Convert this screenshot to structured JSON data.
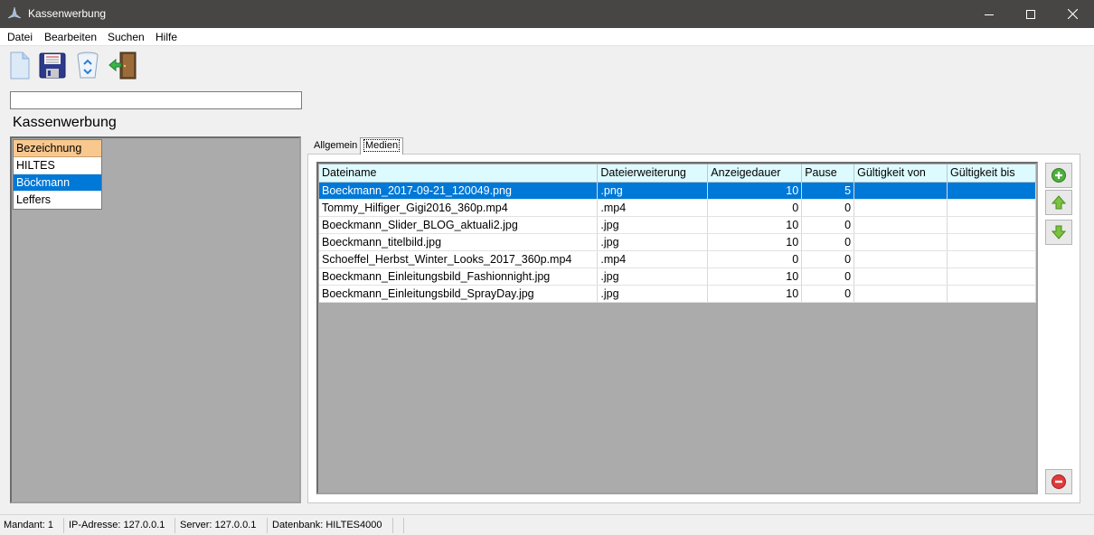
{
  "window": {
    "title": "Kassenwerbung",
    "controls": [
      "minimize-icon",
      "maximize-icon",
      "close-icon"
    ]
  },
  "menu": [
    "Datei",
    "Bearbeiten",
    "Suchen",
    "Hilfe"
  ],
  "toolbar": [
    "new-document-icon",
    "save-icon",
    "recycle-bin-icon",
    "exit-door-icon"
  ],
  "search": {
    "value": "",
    "placeholder": ""
  },
  "heading": "Kassenwerbung",
  "left_list": {
    "header": "Bezeichnung",
    "items": [
      {
        "label": "HILTES",
        "selected": false
      },
      {
        "label": "Böckmann",
        "selected": true
      },
      {
        "label": "Leffers",
        "selected": false
      }
    ]
  },
  "tabs": [
    {
      "label": "Allgemein",
      "active": false
    },
    {
      "label": "Medien",
      "active": true
    }
  ],
  "media_table": {
    "columns": [
      "Dateiname",
      "Dateierweiterung",
      "Anzeigedauer",
      "Pause",
      "Gültigkeit von",
      "Gültigkeit bis"
    ],
    "rows": [
      {
        "file": "Boeckmann_2017-09-21_120049.png",
        "ext": ".png",
        "duration": "10",
        "pause": "5",
        "from": "",
        "to": "",
        "selected": true
      },
      {
        "file": "Tommy_Hilfiger_Gigi2016_360p.mp4",
        "ext": ".mp4",
        "duration": "0",
        "pause": "0",
        "from": "",
        "to": "",
        "selected": false
      },
      {
        "file": "Boeckmann_Slider_BLOG_aktuali2.jpg",
        "ext": ".jpg",
        "duration": "10",
        "pause": "0",
        "from": "",
        "to": "",
        "selected": false
      },
      {
        "file": "Boeckmann_titelbild.jpg",
        "ext": ".jpg",
        "duration": "10",
        "pause": "0",
        "from": "",
        "to": "",
        "selected": false
      },
      {
        "file": "Schoeffel_Herbst_Winter_Looks_2017_360p.mp4",
        "ext": ".mp4",
        "duration": "0",
        "pause": "0",
        "from": "",
        "to": "",
        "selected": false
      },
      {
        "file": "Boeckmann_Einleitungsbild_Fashionnight.jpg",
        "ext": ".jpg",
        "duration": "10",
        "pause": "0",
        "from": "",
        "to": "",
        "selected": false
      },
      {
        "file": "Boeckmann_Einleitungsbild_SprayDay.jpg",
        "ext": ".jpg",
        "duration": "10",
        "pause": "0",
        "from": "",
        "to": "",
        "selected": false
      }
    ]
  },
  "side_buttons": [
    "add-icon",
    "move-up-icon",
    "move-down-icon",
    "remove-icon"
  ],
  "status": [
    "Mandant: 1",
    "IP-Adresse: 127.0.0.1",
    "Server: 127.0.0.1",
    "Datenbank: HILTES4000"
  ],
  "colors": {
    "titlebar": "#474645",
    "selection": "#0078d7",
    "left_header": "#f9c88e",
    "table_header": "#ddfbff",
    "panel_gray": "#ababab"
  }
}
